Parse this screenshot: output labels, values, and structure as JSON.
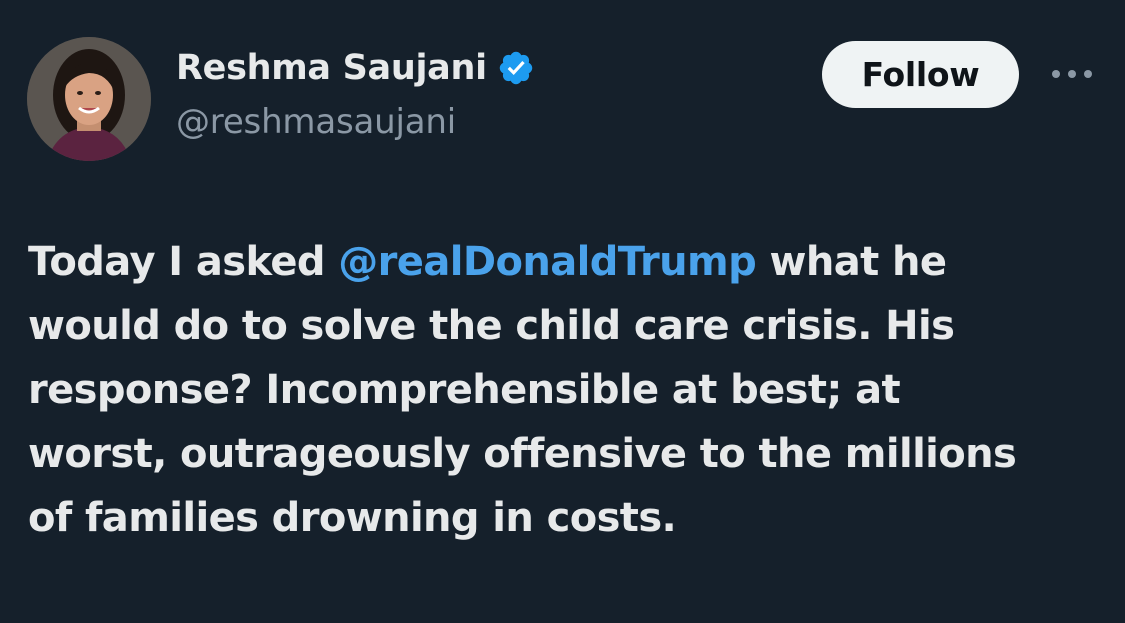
{
  "author": {
    "display_name": "Reshma Saujani",
    "handle": "@reshmasaujani",
    "verified": true,
    "verified_icon": "verified-badge-icon"
  },
  "actions": {
    "follow_label": "Follow",
    "more_icon": "more-options-icon"
  },
  "tweet": {
    "lines": [
      {
        "pre": "Today I asked ",
        "mention": "@realDonaldTrump",
        "post": " what he"
      },
      {
        "text": "would do to solve the child care crisis. His"
      },
      {
        "text": "response? Incomprehensible at best; at"
      },
      {
        "text": "worst, outrageously offensive to the millions"
      },
      {
        "text": "of families drowning in costs."
      }
    ]
  },
  "colors": {
    "background": "#15202b",
    "mention": "#4aa2eb",
    "handle": "#8b98a5",
    "verified": "#1d9bf0",
    "follow_button_bg": "#eff3f4"
  }
}
